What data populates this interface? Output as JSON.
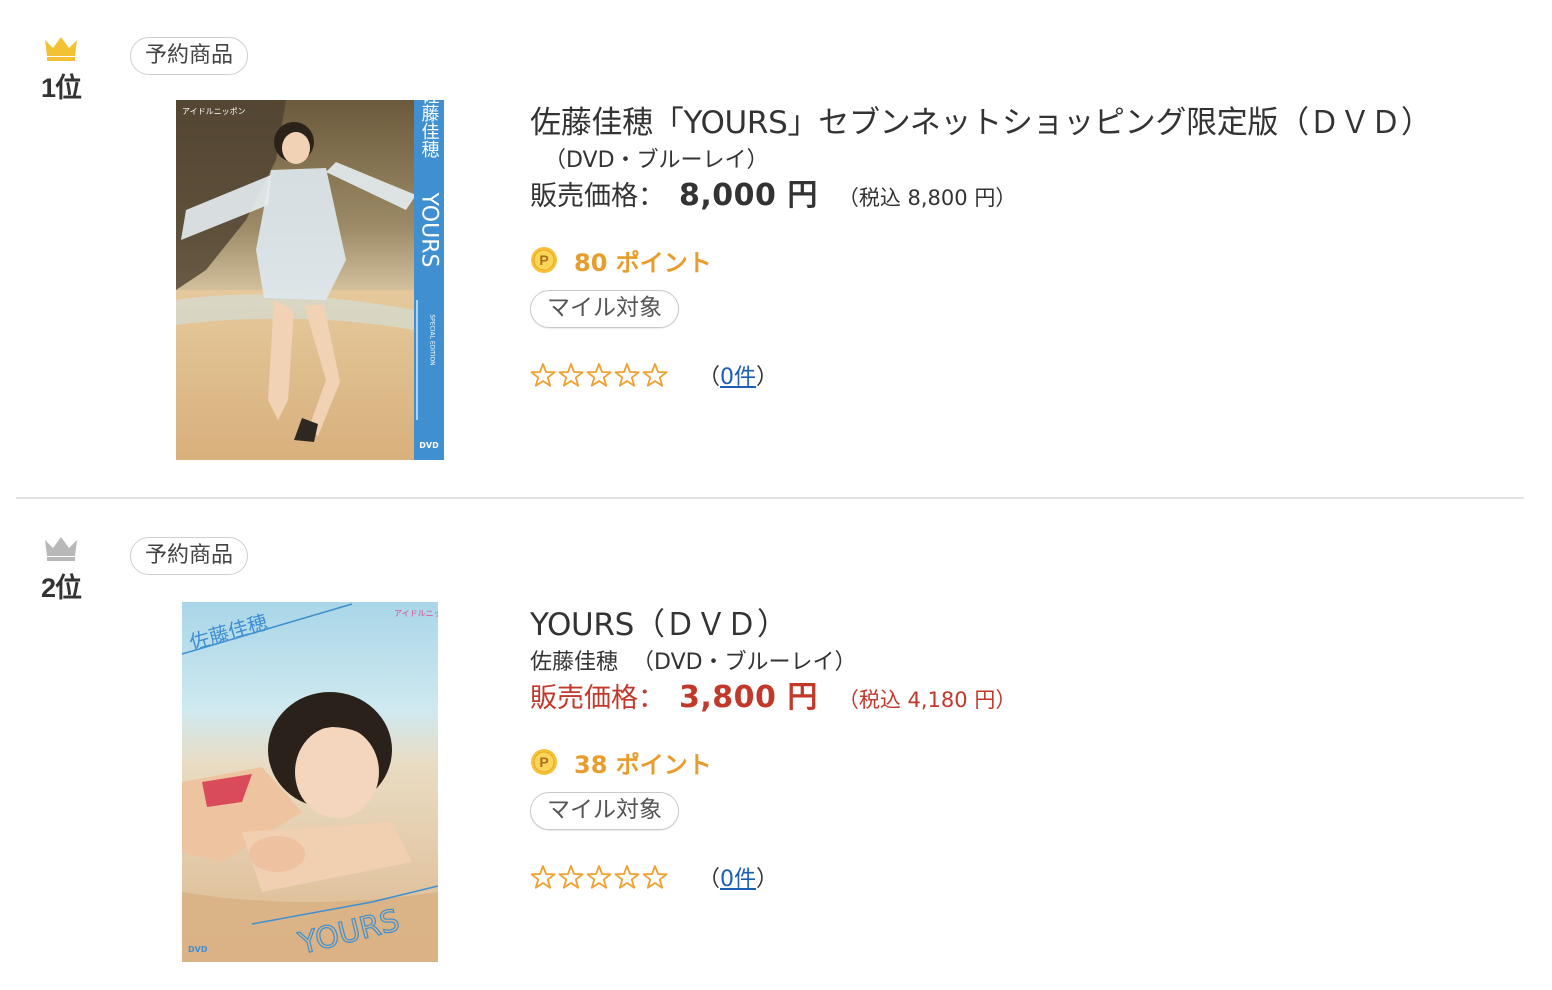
{
  "colors": {
    "gold_crown": "#f3c234",
    "silver_crown": "#b8b8b8",
    "points_orange": "#e89c2c",
    "price_red": "#c0392b",
    "link_blue": "#1a5fb4",
    "star_orange": "#f0a030"
  },
  "items": [
    {
      "rank": "1位",
      "rank_icon": "gold-crown-icon",
      "badge": "予約商品",
      "cover": {
        "label_brand": "アイドルニッポン",
        "label_name": "佐藤佳穂",
        "label_title": "YOURS",
        "label_edition": "SPECIAL EDITION",
        "label_dvd": "DVD"
      },
      "title": "佐藤佳穂「YOURS」セブンネットショッピング限定版（ＤＶＤ）",
      "author": "",
      "format": "（DVD・ブルーレイ）",
      "price_label": "販売価格：",
      "price": "8,000 円",
      "price_tax": "（税込 8,800  円）",
      "points": "80 ポイント",
      "mile": "マイル対象",
      "rating": 0,
      "reviews_open": "（",
      "reviews_link": "0件",
      "reviews_close": "）"
    },
    {
      "rank": "2位",
      "rank_icon": "silver-crown-icon",
      "badge": "予約商品",
      "cover": {
        "label_brand": "アイドルニッポン",
        "label_name": "佐藤佳穂",
        "label_title": "YOURS",
        "label_dvd": "DVD"
      },
      "title": "YOURS（ＤＶＤ）",
      "author": "佐藤佳穂",
      "format": "（DVD・ブルーレイ）",
      "price_label": "販売価格：",
      "price": "3,800 円",
      "price_tax": "（税込 4,180  円）",
      "points": "38 ポイント",
      "mile": "マイル対象",
      "rating": 0,
      "reviews_open": "（",
      "reviews_link": "0件",
      "reviews_close": "）"
    }
  ]
}
